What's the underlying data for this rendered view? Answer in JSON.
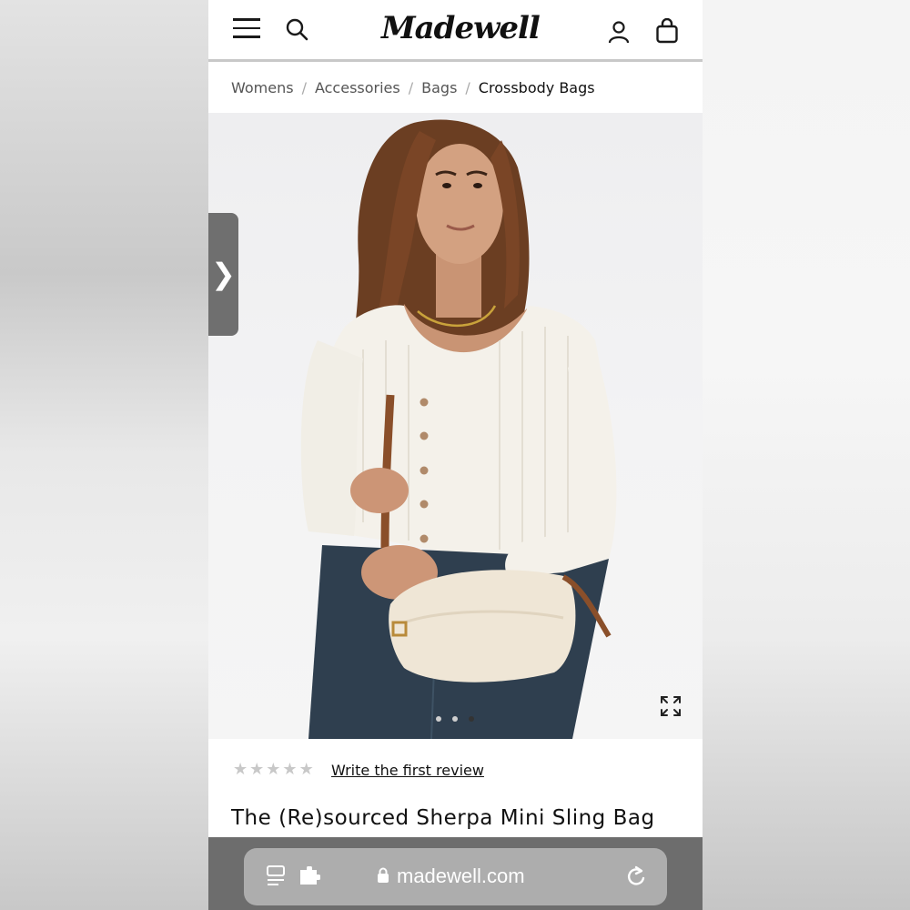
{
  "header": {
    "logo_text": "Madewell",
    "menu_icon": "hamburger-icon",
    "search_icon": "search-icon",
    "account_icon": "account-icon",
    "bag_icon": "shopping-bag-icon"
  },
  "breadcrumb": {
    "items": [
      "Womens",
      "Accessories",
      "Bags"
    ],
    "current": "Crossbody Bags",
    "separator": "/"
  },
  "hero": {
    "side_tab_glyph": "❯",
    "carousel_total": 3,
    "carousel_active_index": 2,
    "expand_icon": "expand-icon"
  },
  "product": {
    "rating_stars_total": 5,
    "rating_stars_filled": 0,
    "review_link": "Write the first review",
    "title": "The (Re)sourced Sherpa Mini Sling Bag"
  },
  "browser": {
    "url": "madewell.com",
    "reader_icon": "reader-mode-icon",
    "extension_icon": "extension-icon",
    "lock_icon": "lock-icon",
    "reload_icon": "reload-icon"
  },
  "colors": {
    "text_dark": "#111111",
    "breadcrumb_text": "#555555",
    "star_empty": "#c8c8c8",
    "browser_bar": "#6d6d6d",
    "url_pill": "#adadad"
  }
}
